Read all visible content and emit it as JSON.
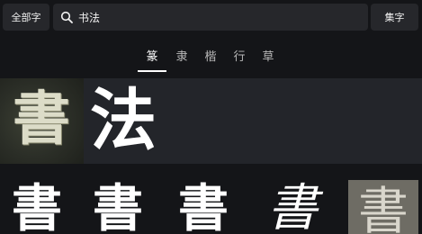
{
  "header": {
    "all_button": "全部字",
    "search_value": "书法",
    "collect_button": "集字"
  },
  "tabs": [
    "篆",
    "隶",
    "楷",
    "行",
    "草"
  ],
  "active_tab": "篆",
  "banner": {
    "rubbing_char": "書",
    "title_char": "法"
  },
  "results": [
    "書",
    "書",
    "書",
    "書",
    "書"
  ],
  "colors": {
    "background": "#141518",
    "button": "#26272b",
    "banner": "#23252a",
    "text": "#ffffff"
  }
}
